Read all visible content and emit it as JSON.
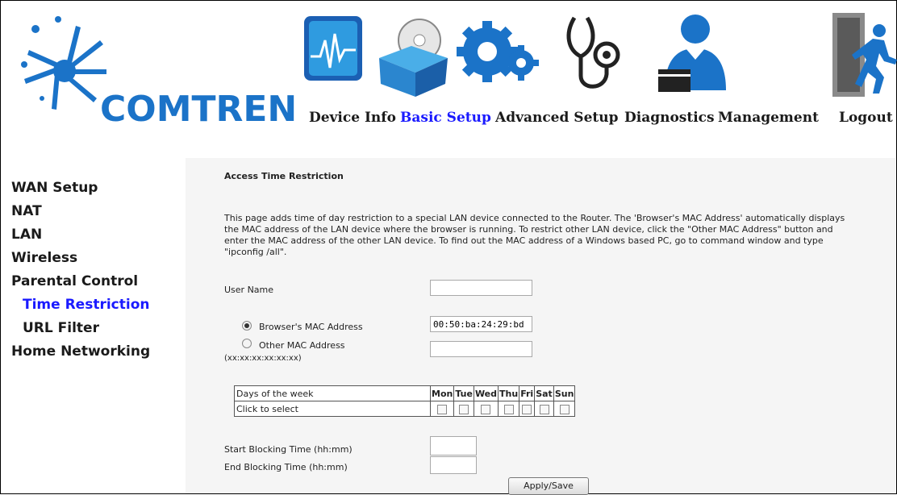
{
  "brand": {
    "name": "COMTREND",
    "logo_color": "#1b73c8"
  },
  "nav": {
    "items": [
      {
        "label": "Device Info",
        "icon": "monitor-graph-icon",
        "active": false
      },
      {
        "label": "Basic Setup",
        "icon": "open-box-disc-icon",
        "active": true
      },
      {
        "label": "Advanced Setup",
        "icon": "gears-icon",
        "active": false
      },
      {
        "label": "Diagnostics",
        "icon": "stethoscope-icon",
        "active": false
      },
      {
        "label": "Management",
        "icon": "user-briefcase-icon",
        "active": false
      },
      {
        "label": "Logout",
        "icon": "exit-door-icon",
        "active": false
      }
    ]
  },
  "sidebar": {
    "items": [
      {
        "label": "WAN Setup"
      },
      {
        "label": "NAT"
      },
      {
        "label": "LAN"
      },
      {
        "label": "Wireless"
      },
      {
        "label": "Parental Control"
      },
      {
        "label": "Time Restriction",
        "sub": true,
        "active": true
      },
      {
        "label": "URL Filter",
        "sub": true
      },
      {
        "label": "Home Networking"
      }
    ]
  },
  "page": {
    "title": "Access Time Restriction",
    "description": "This page adds time of day restriction to a special LAN device connected to the Router. The 'Browser's MAC Address' automatically displays the MAC address of the LAN device where the browser is running. To restrict other LAN device, click the \"Other MAC Address\" button and enter the MAC address of the other LAN device. To find out the MAC address of a Windows based PC, go to command window and type \"ipconfig /all\".",
    "user_name_label": "User Name",
    "user_name_value": "",
    "browser_mac_label": "Browser's MAC Address",
    "browser_mac_value": "00:50:ba:24:29:bd",
    "other_mac_label": "Other MAC Address",
    "other_mac_format": "(xx:xx:xx:xx:xx:xx)",
    "other_mac_value": "",
    "selected_mac_option": "browser",
    "days_header": "Days of the week",
    "days_row_label": "Click to select",
    "days": [
      "Mon",
      "Tue",
      "Wed",
      "Thu",
      "Fri",
      "Sat",
      "Sun"
    ],
    "start_label": "Start Blocking Time (hh:mm)",
    "end_label": "End Blocking Time (hh:mm)",
    "start_value": "",
    "end_value": "",
    "apply_label": "Apply/Save"
  },
  "colors": {
    "active_link": "#1a1aff",
    "content_bg": "#f5f5f5"
  }
}
